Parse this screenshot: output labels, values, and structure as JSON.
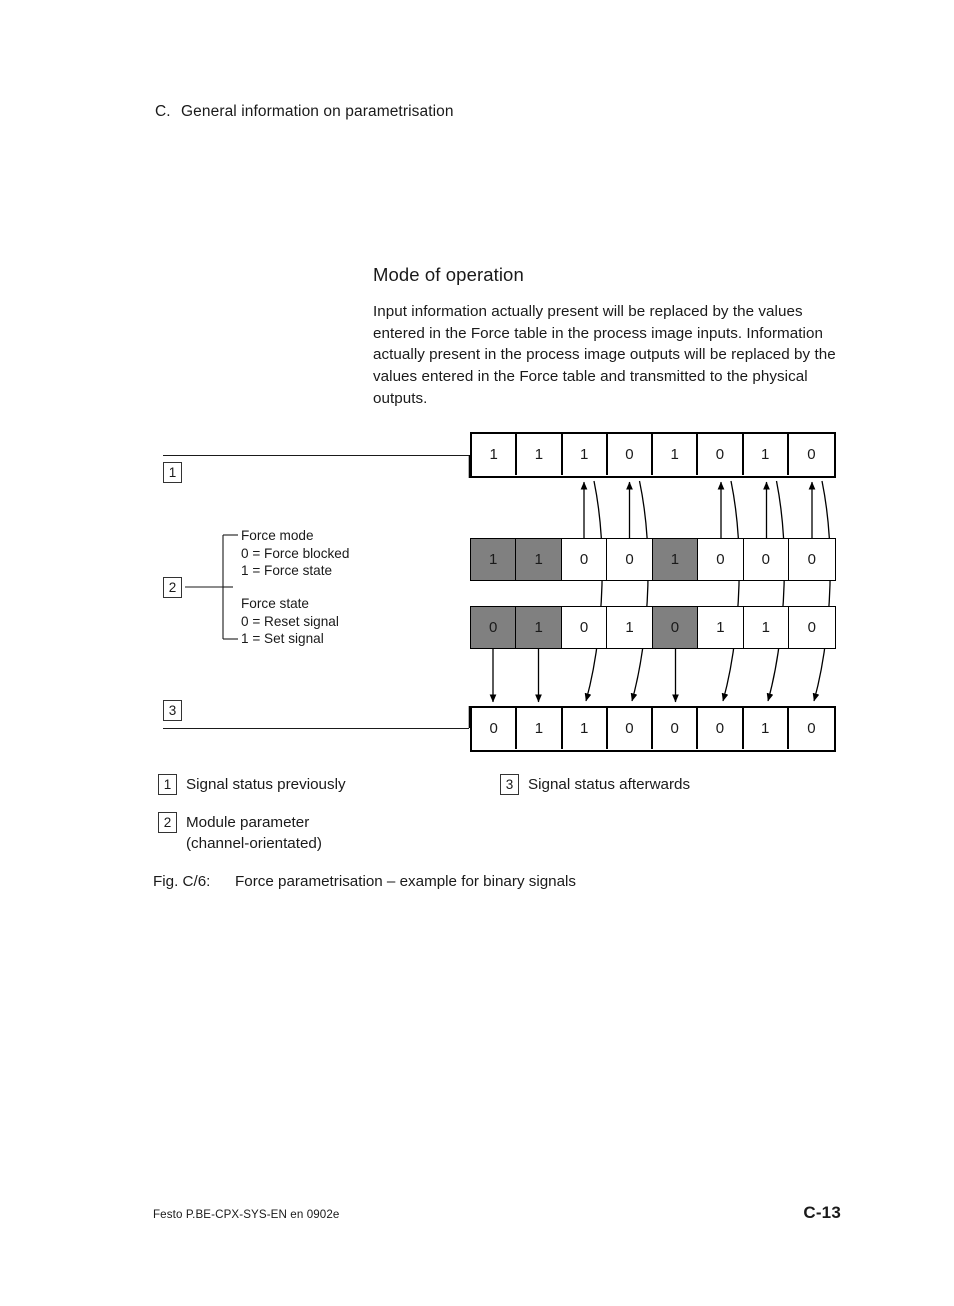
{
  "running_head": {
    "letter": "C.",
    "text": "General information on parametrisation"
  },
  "section": {
    "title": "Mode of operation",
    "paragraph": "Input information actually present will be replaced by the values entered in the Force table in the process image inputs. Information actually present in the process image outputs will be replaced by the values entered in the Force table and transmitted to the physical outputs."
  },
  "markers": {
    "one": "1",
    "two": "2",
    "three": "3"
  },
  "module_parameter_legend": {
    "force_mode": {
      "title": "Force mode",
      "option_0": "0 = Force blocked",
      "option_1": "1 = Force state"
    },
    "force_state": {
      "title": "Force state",
      "option_0": "0 = Reset signal",
      "option_1": "1 = Set signal"
    }
  },
  "diagram": {
    "rows": [
      {
        "name": "signal-status-previously",
        "weight": "thick",
        "values": [
          "1",
          "1",
          "1",
          "0",
          "1",
          "0",
          "1",
          "0"
        ],
        "shaded": [
          false,
          false,
          false,
          false,
          false,
          false,
          false,
          false
        ]
      },
      {
        "name": "force-mode",
        "weight": "thin",
        "values": [
          "1",
          "1",
          "0",
          "0",
          "1",
          "0",
          "0",
          "0"
        ],
        "shaded": [
          true,
          true,
          false,
          false,
          true,
          false,
          false,
          false
        ]
      },
      {
        "name": "force-state",
        "weight": "thin",
        "values": [
          "0",
          "1",
          "0",
          "1",
          "0",
          "1",
          "1",
          "0"
        ],
        "shaded": [
          true,
          true,
          false,
          false,
          true,
          false,
          false,
          false
        ]
      },
      {
        "name": "signal-status-afterwards",
        "weight": "thick",
        "values": [
          "0",
          "1",
          "1",
          "0",
          "0",
          "0",
          "1",
          "0"
        ],
        "shaded": [
          false,
          false,
          false,
          false,
          false,
          false,
          false,
          false
        ]
      }
    ],
    "forced_channels": [
      1,
      2,
      5
    ],
    "passthrough_channels": [
      3,
      4,
      6,
      7,
      8
    ],
    "shade_color": "#808080"
  },
  "legend": [
    {
      "num": "1",
      "text": "Signal status previously"
    },
    {
      "num": "2",
      "text": "Module parameter\n(channel-orientated)"
    },
    {
      "num": "3",
      "text": "Signal status afterwards"
    }
  ],
  "caption": {
    "label": "Fig. C/6:",
    "text": "Force parametrisation – example for binary signals"
  },
  "footer": {
    "left": "Festo P.BE-CPX-SYS-EN  en 0902e",
    "right": "C-13"
  }
}
